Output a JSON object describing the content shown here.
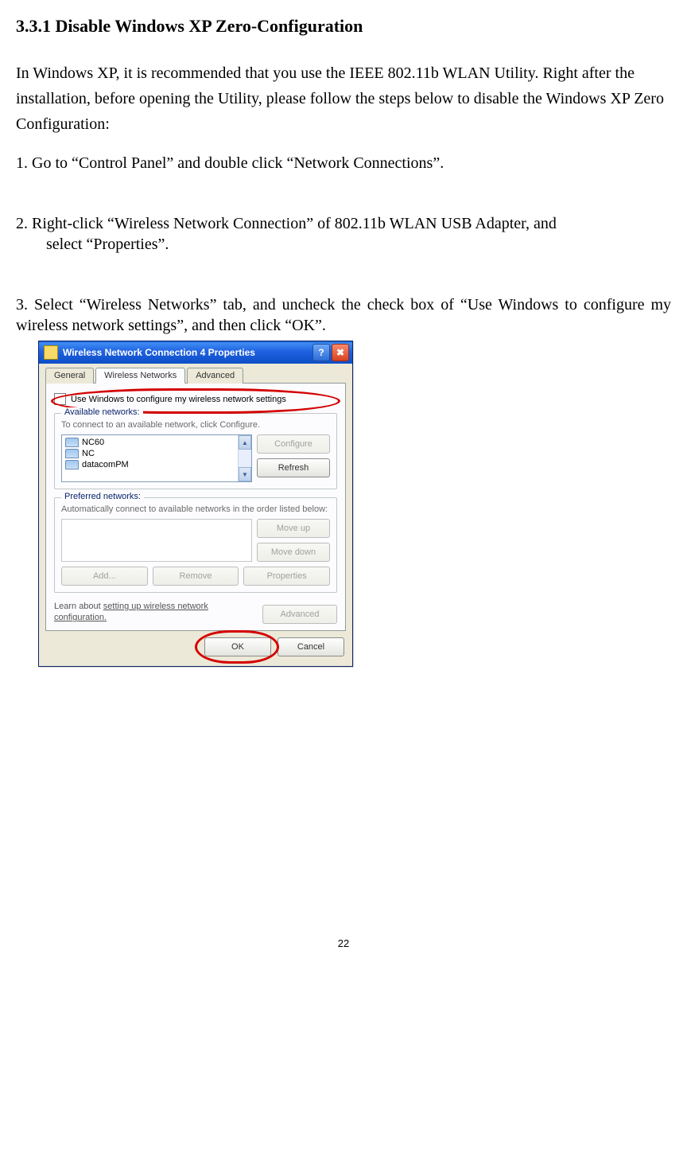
{
  "section_heading": "3.3.1 Disable Windows XP Zero-Configuration",
  "intro": "In Windows XP, it is recommended that you use the IEEE 802.11b WLAN Utility. Right after the installation, before opening the Utility, please follow the steps below to disable the Windows XP Zero Configuration:",
  "step1": "1. Go to “Control Panel” and double click “Network Connections”.",
  "step2_l1": "2. Right-click “Wireless Network Connection” of 802.11b WLAN USB Adapter, and",
  "step2_l2": "select “Properties”.",
  "step3_l1": "3. Select “Wireless Networks” tab, and uncheck the check box of “Use Windows to",
  "step3_l2": "configure my wireless network settings”, and then click “OK”.",
  "dialog": {
    "title": "Wireless Network Connection 4 Properties",
    "help_glyph": "?",
    "close_glyph": "✖",
    "tabs": {
      "general": "General",
      "wireless": "Wireless Networks",
      "advanced": "Advanced"
    },
    "checkbox_label": "Use Windows to configure my wireless network settings",
    "available": {
      "title": "Available networks:",
      "hint": "To connect to an available network, click Configure.",
      "items": [
        "NC60",
        "NC",
        "datacomPM"
      ],
      "scroll_up": "▲",
      "scroll_down": "▼",
      "btn_configure": "Configure",
      "btn_refresh": "Refresh"
    },
    "preferred": {
      "title": "Preferred networks:",
      "hint": "Automatically connect to available networks in the order listed below:",
      "btn_moveup": "Move up",
      "btn_movedown": "Move down",
      "btn_add": "Add...",
      "btn_remove": "Remove",
      "btn_properties": "Properties"
    },
    "learn_prefix": "Learn about ",
    "learn_link": "setting up wireless network configuration.",
    "btn_advanced": "Advanced",
    "btn_ok": "OK",
    "btn_cancel": "Cancel"
  },
  "page_number": "22"
}
